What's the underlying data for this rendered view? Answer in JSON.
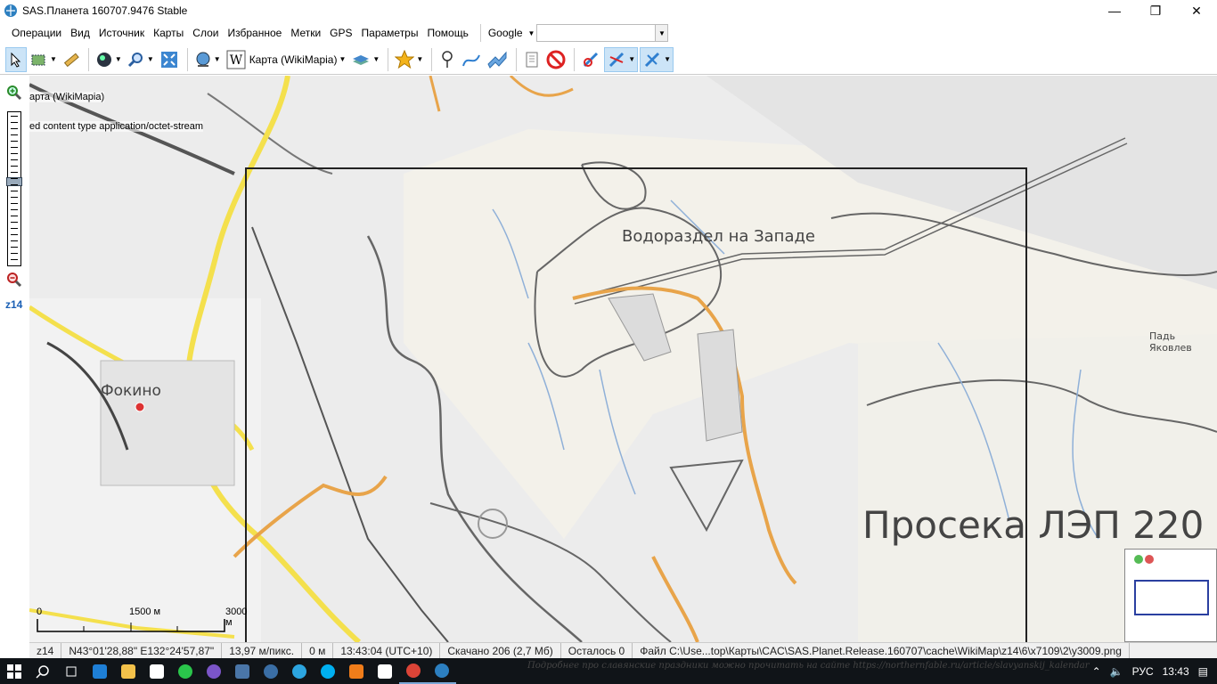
{
  "window": {
    "title": "SAS.Планета 160707.9476 Stable",
    "minimize": "—",
    "maximize": "❐",
    "close": "✕"
  },
  "menu": [
    "Операции",
    "Вид",
    "Источник",
    "Карты",
    "Слои",
    "Избранное",
    "Метки",
    "GPS",
    "Параметры",
    "Помощь"
  ],
  "search": {
    "engine": "Google",
    "query": ""
  },
  "toolbar": {
    "map_name": "Карта (WikiMapia)"
  },
  "left_panel": {
    "zoom_level": "z14",
    "zoom_fraction": 0.45
  },
  "map": {
    "error_line1": "арта (WikiMapia)",
    "error_line2": "ed content type application/octet-stream",
    "labels": {
      "watershed": "Водораздел на Западе",
      "fokino": "Фокино",
      "pad": "Падь Яковлев",
      "proseka": "Просека ЛЭП 220"
    },
    "scale": {
      "s0": "0",
      "s1": "1500 м",
      "s2": "3000 м"
    }
  },
  "status": {
    "zoom": "z14",
    "coords": "N43°01'28,88\" E132°24'57,87\"",
    "resolution": "13,97 м/пикс.",
    "distance": "0 м",
    "time": "13:43:04 (UTC+10)",
    "downloaded": "Скачано 206 (2,7 Мб)",
    "remaining": "Осталось 0",
    "file": "Файл C:\\Use...top\\Карты\\CAC\\SAS.Planet.Release.160707\\cache\\WikiMap\\z14\\6\\x7109\\2\\y3009.png"
  },
  "taskbar": {
    "ticker": "Подробнее про славянские праздники можно прочитать на сайте https://northernfable.ru/article/slavyanskij_kalendar",
    "lang": "РУС",
    "clock": "13:43"
  },
  "colors": {
    "road": "#f4e04d",
    "track": "#e8a44a",
    "water": "#7fa7d6",
    "contour": "#555555"
  }
}
